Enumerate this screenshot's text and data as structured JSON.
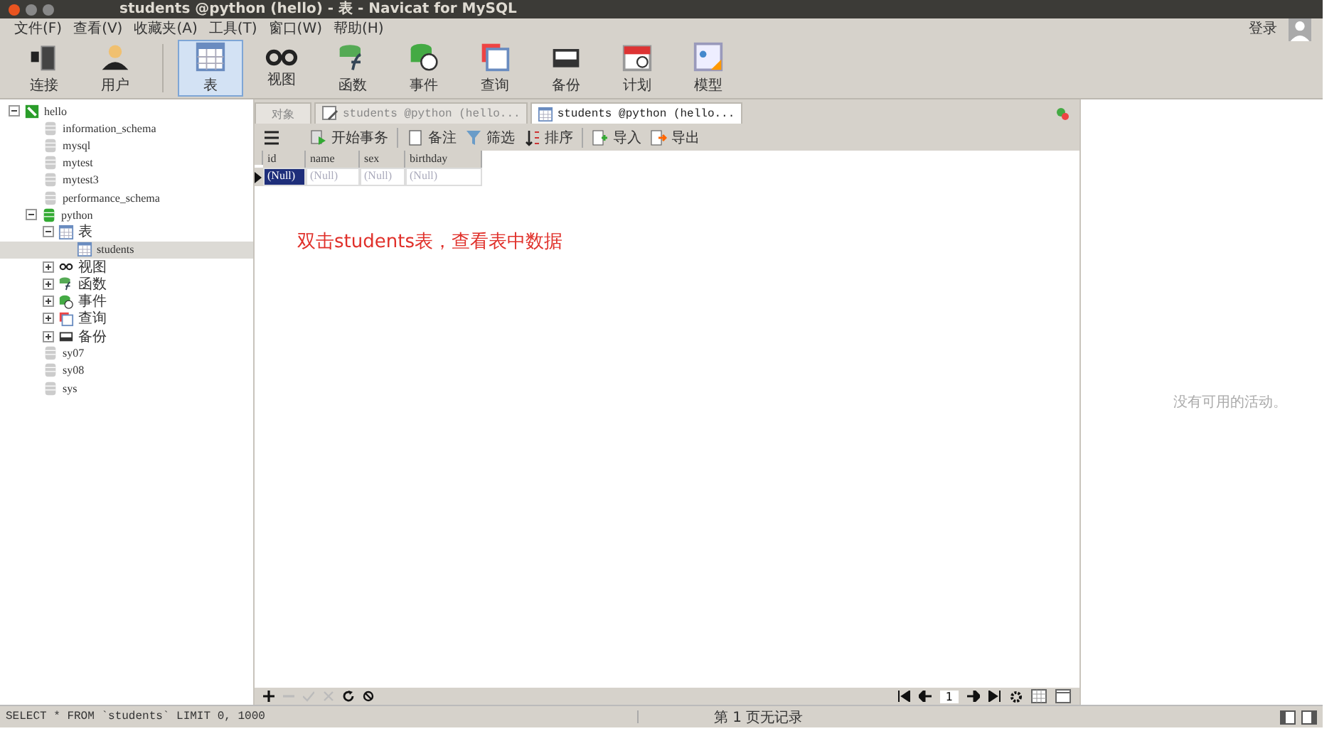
{
  "window": {
    "title": "students @python (hello) - 表 - Navicat for MySQL"
  },
  "menu": [
    "文件(F)",
    "查看(V)",
    "收藏夹(A)",
    "工具(T)",
    "窗口(W)",
    "帮助(H)"
  ],
  "toolbar": [
    {
      "kind": "connection",
      "label": "连接",
      "selected": false
    },
    {
      "kind": "user",
      "label": "用户",
      "selected": false
    },
    {
      "kind": "table",
      "label": "表",
      "selected": true
    },
    {
      "kind": "view",
      "label": "视图",
      "selected": false
    },
    {
      "kind": "function",
      "label": "函数",
      "selected": false
    },
    {
      "kind": "event",
      "label": "事件",
      "selected": false
    },
    {
      "kind": "query",
      "label": "查询",
      "selected": false
    },
    {
      "kind": "backup",
      "label": "备份",
      "selected": false
    },
    {
      "kind": "schedule",
      "label": "计划",
      "selected": false
    },
    {
      "kind": "model",
      "label": "模型",
      "selected": false
    }
  ],
  "login": "登录",
  "tree": [
    {
      "kind": "connection",
      "label": "hello",
      "expanded": true,
      "selected": false,
      "children": [
        {
          "kind": "database",
          "label": "information_schema",
          "selected": false
        },
        {
          "kind": "database",
          "label": "mysql",
          "selected": false
        },
        {
          "kind": "database",
          "label": "mytest",
          "selected": false
        },
        {
          "kind": "database",
          "label": "mytest3",
          "selected": false
        },
        {
          "kind": "database",
          "label": "performance_schema",
          "selected": false
        },
        {
          "kind": "open-database",
          "label": "python",
          "expanded": true,
          "selected": false,
          "children": [
            {
              "kind": "table",
              "label": "表",
              "expanded": true,
              "selected": false,
              "children": [
                {
                  "kind": "table",
                  "label": "students",
                  "selected": true
                }
              ]
            },
            {
              "kind": "view",
              "label": "视图",
              "expanded": false,
              "selected": false
            },
            {
              "kind": "function",
              "label": "函数",
              "expanded": false,
              "selected": false
            },
            {
              "kind": "event",
              "label": "事件",
              "expanded": false,
              "selected": false
            },
            {
              "kind": "query",
              "label": "查询",
              "expanded": false,
              "selected": false
            },
            {
              "kind": "backup",
              "label": "备份",
              "expanded": false,
              "selected": false
            }
          ]
        },
        {
          "kind": "database",
          "label": "sy07",
          "selected": false
        },
        {
          "kind": "database",
          "label": "sy08",
          "selected": false
        },
        {
          "kind": "database",
          "label": "sys",
          "selected": false
        }
      ]
    }
  ],
  "tabs": [
    {
      "kind": "plain",
      "label": "对象",
      "selected": false
    },
    {
      "kind": "design",
      "label": "students @python (hello...",
      "selected": false
    },
    {
      "kind": "table",
      "label": "students @python (hello...",
      "selected": true
    }
  ],
  "table_toolbar": [
    {
      "kind": "transaction",
      "label": "开始事务"
    },
    {
      "kind": "note",
      "label": "备注"
    },
    {
      "kind": "filter",
      "label": "筛选"
    },
    {
      "kind": "sort",
      "label": "排序"
    },
    {
      "kind": "import",
      "label": "导入"
    },
    {
      "kind": "export",
      "label": "导出"
    }
  ],
  "grid": {
    "columns": [
      "id",
      "name",
      "sex",
      "birthday"
    ],
    "rows": [
      {
        "selected": true,
        "cells": [
          "(Null)",
          "(Null)",
          "(Null)",
          "(Null)"
        ]
      }
    ]
  },
  "annotation": "双击students表，查看表中数据",
  "page_number": "1",
  "activity": "没有可用的活动。",
  "status_bar": {
    "sql": "SELECT * FROM `students` LIMIT 0, 1000",
    "page": "第 1 页无记录"
  }
}
